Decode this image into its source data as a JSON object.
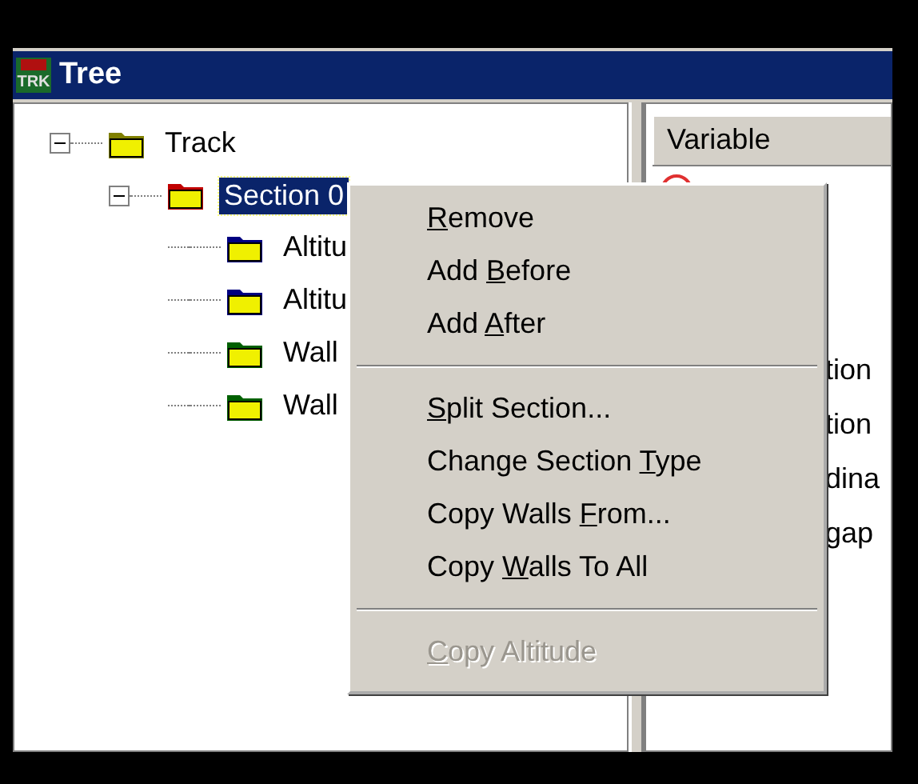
{
  "window": {
    "title": "Tree",
    "logo_text": "TRK"
  },
  "tree": [
    {
      "label": "Track",
      "color": "#808000",
      "expanded": true,
      "selected": false,
      "children": [
        {
          "label": "Section 0",
          "color": "#c00000",
          "expanded": true,
          "selected": true,
          "children": [
            {
              "label": "Altitu",
              "color": "#000080",
              "selected": false
            },
            {
              "label": "Altitu",
              "color": "#000080",
              "selected": false
            },
            {
              "label": "Wall",
              "color": "#006000",
              "selected": false
            },
            {
              "label": "Wall",
              "color": "#006000",
              "selected": false
            }
          ]
        }
      ]
    }
  ],
  "table": {
    "columns": [
      "Variable"
    ],
    "rows": [
      "tion",
      "tion",
      "dina",
      "gap"
    ]
  },
  "context_menu": [
    {
      "kind": "item",
      "key": "R",
      "post": "emove",
      "disabled": false
    },
    {
      "kind": "item",
      "pre": "Add ",
      "key": "B",
      "post": "efore",
      "disabled": false
    },
    {
      "kind": "item",
      "pre": "Add ",
      "key": "A",
      "post": "fter",
      "disabled": false
    },
    {
      "kind": "separator"
    },
    {
      "kind": "item",
      "key": "S",
      "post": "plit Section...",
      "disabled": false
    },
    {
      "kind": "item",
      "pre": "Change Section ",
      "key": "T",
      "post": "ype",
      "disabled": false
    },
    {
      "kind": "item",
      "pre": "Copy Walls ",
      "key": "F",
      "post": "rom...",
      "disabled": false
    },
    {
      "kind": "item",
      "pre": "Copy ",
      "key": "W",
      "post": "alls To All",
      "disabled": false
    },
    {
      "kind": "separator"
    },
    {
      "kind": "item",
      "key": "C",
      "post": "opy Altitude",
      "disabled": true
    }
  ]
}
